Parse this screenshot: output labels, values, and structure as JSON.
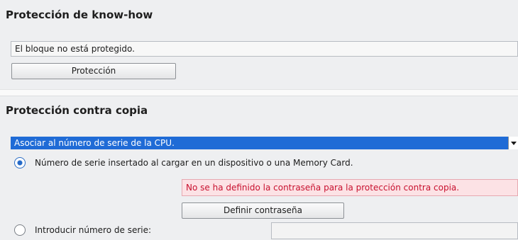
{
  "know_how": {
    "title": "Protección de know-how",
    "status_text": "El bloque no está protegido.",
    "protect_button_label": "Protección"
  },
  "copy_protection": {
    "title": "Protección contra copia",
    "selected_option": "Asociar al número de serie de la CPU.",
    "radio_options": [
      {
        "label": "Número de serie insertado al cargar en un dispositivo o una Memory Card.",
        "checked": true
      },
      {
        "label": "Introducir número de serie:",
        "checked": false
      }
    ],
    "warning_text": "No se ha definido la contraseña para la protección contra copia.",
    "set_password_button_label": "Definir contraseña",
    "serial_number_value": ""
  },
  "colors": {
    "select_highlight": "#1f6bd6",
    "warning_background": "#fce2e5",
    "warning_text": "#c8102e",
    "radio_selected": "#2469c8"
  }
}
